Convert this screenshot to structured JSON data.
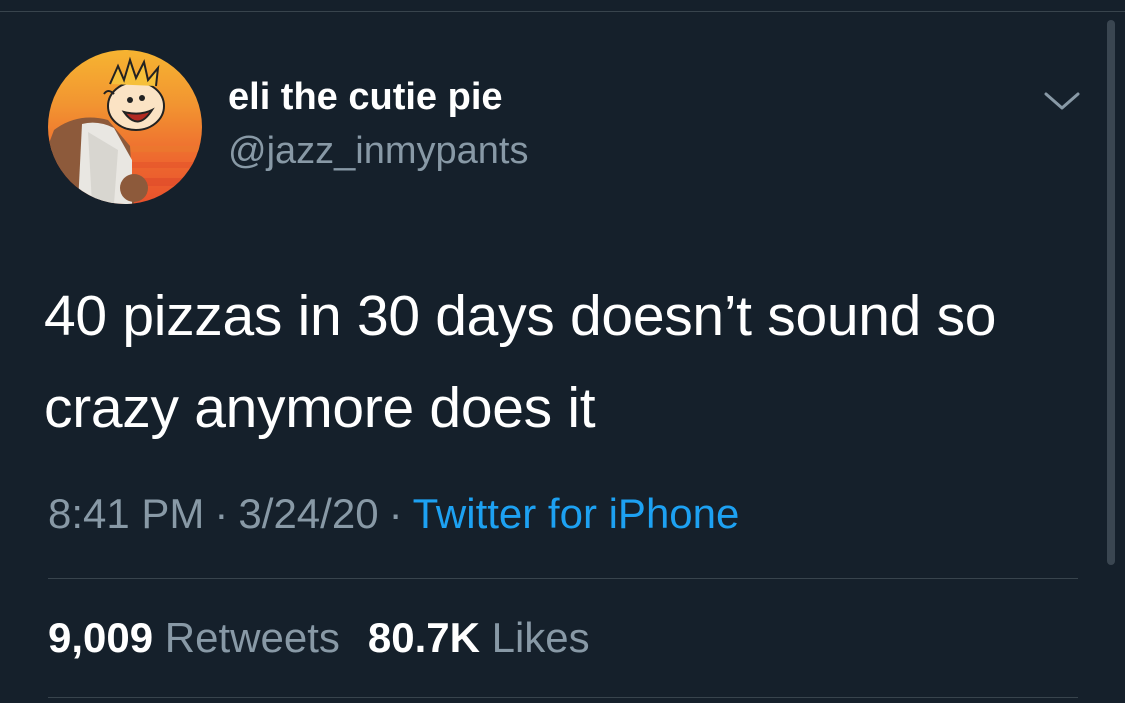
{
  "user": {
    "display_name": "eli the cutie pie",
    "handle": "@jazz_inmypants",
    "avatar_icon": "cartoon-avatar"
  },
  "tweet": {
    "text": "40 pizzas in 30 days doesn’t sound so crazy anymore does it",
    "time": "8:41 PM",
    "date": "3/24/20",
    "separator": "·",
    "source": "Twitter for iPhone"
  },
  "stats": {
    "retweets_count": "9,009",
    "retweets_label": "Retweets",
    "likes_count": "80.7K",
    "likes_label": "Likes"
  },
  "colors": {
    "background": "#15202b",
    "text_primary": "#ffffff",
    "text_secondary": "#8899a6",
    "accent": "#1da1f2",
    "divider": "#38444d"
  }
}
